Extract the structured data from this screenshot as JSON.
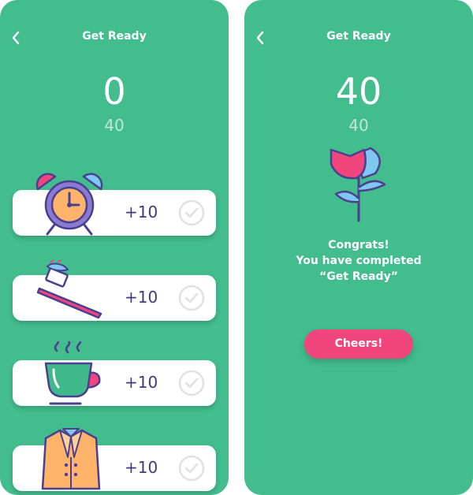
{
  "colors": {
    "background": "#43BC8E",
    "card": "#FFFFFF",
    "accent": "#F0457D",
    "text_dark": "#3F3A7A",
    "text_muted": "#BEE7D6"
  },
  "screen_left": {
    "title": "Get Ready",
    "score": "0",
    "target": "40",
    "tasks": [
      {
        "icon": "alarm-clock-icon",
        "points": "+10"
      },
      {
        "icon": "toothbrush-icon",
        "points": "+10"
      },
      {
        "icon": "coffee-cup-icon",
        "points": "+10"
      },
      {
        "icon": "coat-icon",
        "points": "+10"
      }
    ]
  },
  "screen_right": {
    "title": "Get Ready",
    "score": "40",
    "target": "40",
    "icon": "flower-icon",
    "congrats_line1": "Congrats!",
    "congrats_line2": "You have completed",
    "congrats_line3": "“Get Ready”",
    "cheers_label": "Cheers!"
  }
}
